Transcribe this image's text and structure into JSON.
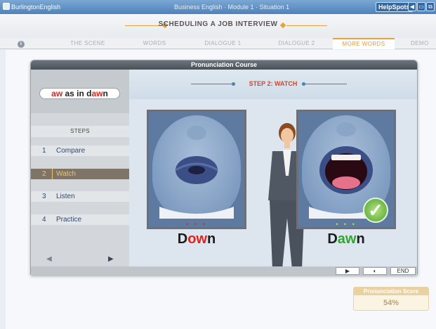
{
  "window": {
    "app_name": "BurlingtonEnglish",
    "breadcrumb": "Business English · Module 1 · Situation 1",
    "helpspots": "HelpSpots",
    "controls": [
      "◀",
      "▭",
      "⧉",
      "▮"
    ]
  },
  "header": {
    "title": "SCHEDULING A JOB INTERVIEW"
  },
  "tabs": [
    {
      "label": "THE SCENE"
    },
    {
      "label": "WORDS"
    },
    {
      "label": "DIALOGUE 1"
    },
    {
      "label": "DIALOGUE 2"
    },
    {
      "label": "MORE WORDS",
      "active": true
    },
    {
      "label": "DEMO"
    }
  ],
  "course": {
    "title": "Pronunciation Course",
    "sound": {
      "part1": "aw",
      "part2": " as in d",
      "part3": "aw",
      "part4": "n"
    },
    "steps_heading": "STEPS",
    "steps": [
      {
        "num": "1",
        "label": "Compare"
      },
      {
        "num": "2",
        "label": "Watch",
        "active": true
      },
      {
        "num": "3",
        "label": "Listen"
      },
      {
        "num": "4",
        "label": "Practice"
      }
    ],
    "banner": "STEP 2: WATCH",
    "left_word": {
      "part1": "D",
      "part2": "ow",
      "part3": "n"
    },
    "right_word": {
      "part1": "D",
      "part2": "aw",
      "part3": "n"
    },
    "dots_left": "• • •",
    "dots_right": "• • •",
    "controls": {
      "play": "▶",
      "globe": "◐",
      "end": "END"
    }
  },
  "score": {
    "label": "Pronunciation Score",
    "value": "54%"
  },
  "colors": {
    "accent": "#e6a23c",
    "red": "#e0231b",
    "green": "#2fa62f"
  }
}
